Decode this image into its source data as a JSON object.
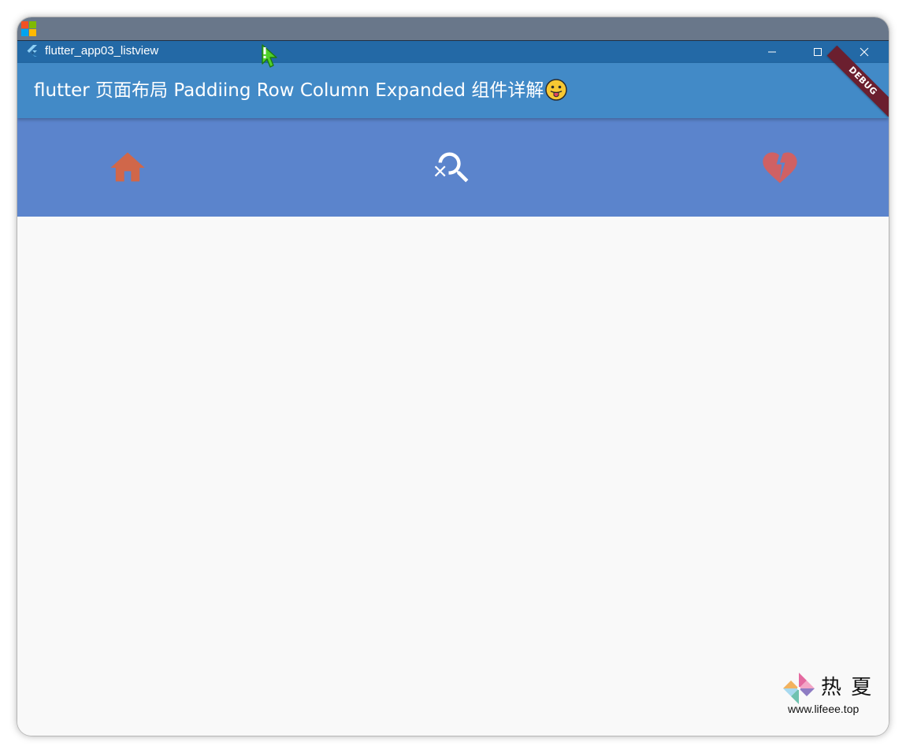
{
  "window": {
    "title": "flutter_app03_listview",
    "controls": {
      "minimize": "minimize-icon",
      "maximize": "maximize-icon",
      "close": "close-icon"
    }
  },
  "appbar": {
    "title": "flutter 页面布局 Paddiing Row Column Expanded 组件详解",
    "emoji": "😛",
    "debug_banner": "DEBUG"
  },
  "icon_row": {
    "items": [
      {
        "icon": "home-icon",
        "color": "#d0674a"
      },
      {
        "icon": "search-off-icon",
        "color": "#ffffff"
      },
      {
        "icon": "heart-broken-icon",
        "color": "#cf6164"
      }
    ]
  },
  "colors": {
    "titlebar": "#2369a6",
    "appbar": "#428ac7",
    "icon_row_bg": "#5b84cc",
    "body_bg": "#f9f9f9"
  },
  "watermark": {
    "name": "热 夏",
    "url": "www.lifeee.top"
  }
}
